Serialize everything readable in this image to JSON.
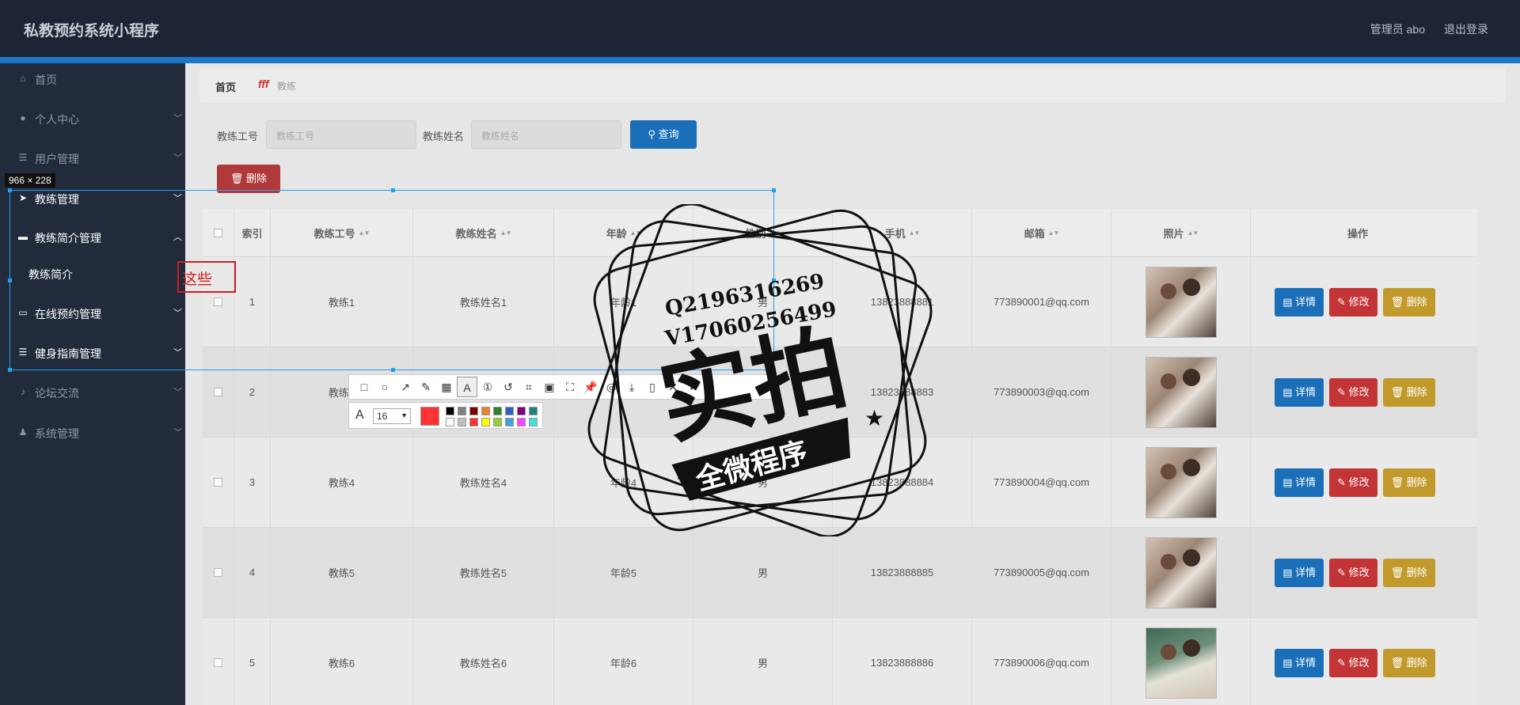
{
  "app": {
    "title": "私教预约系统小程序",
    "user": "管理员 abo",
    "logout": "退出登录"
  },
  "sidebar": {
    "items": [
      {
        "label": "首页",
        "icon": "home-icon"
      },
      {
        "label": "个人中心",
        "icon": "user-icon"
      },
      {
        "label": "用户管理",
        "icon": "list-icon"
      },
      {
        "label": "教练管理",
        "icon": "send-icon"
      },
      {
        "label": "教练简介管理",
        "icon": "flag-icon"
      },
      {
        "label": "教练简介",
        "icon": ""
      },
      {
        "label": "在线预约管理",
        "icon": "chat-icon"
      },
      {
        "label": "健身指南管理",
        "icon": "list-icon"
      },
      {
        "label": "论坛交流",
        "icon": "mic-icon"
      },
      {
        "label": "系统管理",
        "icon": "person-icon"
      }
    ]
  },
  "breadcrumb": {
    "home": "首页",
    "separator": "fff",
    "current": "教练"
  },
  "search": {
    "id_label": "教练工号",
    "id_placeholder": "教练工号",
    "name_label": "教练姓名",
    "name_placeholder": "教练姓名",
    "query_button": "查询",
    "delete_button": "删除"
  },
  "table": {
    "headers": [
      "",
      "索引",
      "教练工号",
      "教练姓名",
      "年龄",
      "性别",
      "手机",
      "邮箱",
      "照片",
      "操作"
    ],
    "rows": [
      {
        "index": "1",
        "id": "教练1",
        "name": "教练姓名1",
        "age": "年龄1",
        "gender": "男",
        "phone": "13823888881",
        "email": "773890001@qq.com"
      },
      {
        "index": "2",
        "id": "教练3",
        "name": "教练姓名3",
        "age": "年龄3",
        "gender": "男",
        "phone": "13823888883",
        "email": "773890003@qq.com"
      },
      {
        "index": "3",
        "id": "教练4",
        "name": "教练姓名4",
        "age": "年龄4",
        "gender": "男",
        "phone": "13823888884",
        "email": "773890004@qq.com"
      },
      {
        "index": "4",
        "id": "教练5",
        "name": "教练姓名5",
        "age": "年龄5",
        "gender": "男",
        "phone": "13823888885",
        "email": "773890005@qq.com"
      },
      {
        "index": "5",
        "id": "教练6",
        "name": "教练姓名6",
        "age": "年龄6",
        "gender": "男",
        "phone": "13823888886",
        "email": "773890006@qq.com"
      }
    ],
    "actions": {
      "detail": "详情",
      "edit": "修改",
      "delete": "删除"
    }
  },
  "overlay": {
    "size_tag": "966 × 228",
    "annotation_text": "这些",
    "font_size": "16"
  },
  "watermark": {
    "line1": "Q2196316269",
    "line2": "V17060256499",
    "big": "实拍",
    "banner": "全微程序"
  },
  "colors": {
    "accent": "#1a6fb8",
    "danger": "#c23436",
    "warning": "#c29a2b",
    "annotation": "#d01e1e"
  }
}
